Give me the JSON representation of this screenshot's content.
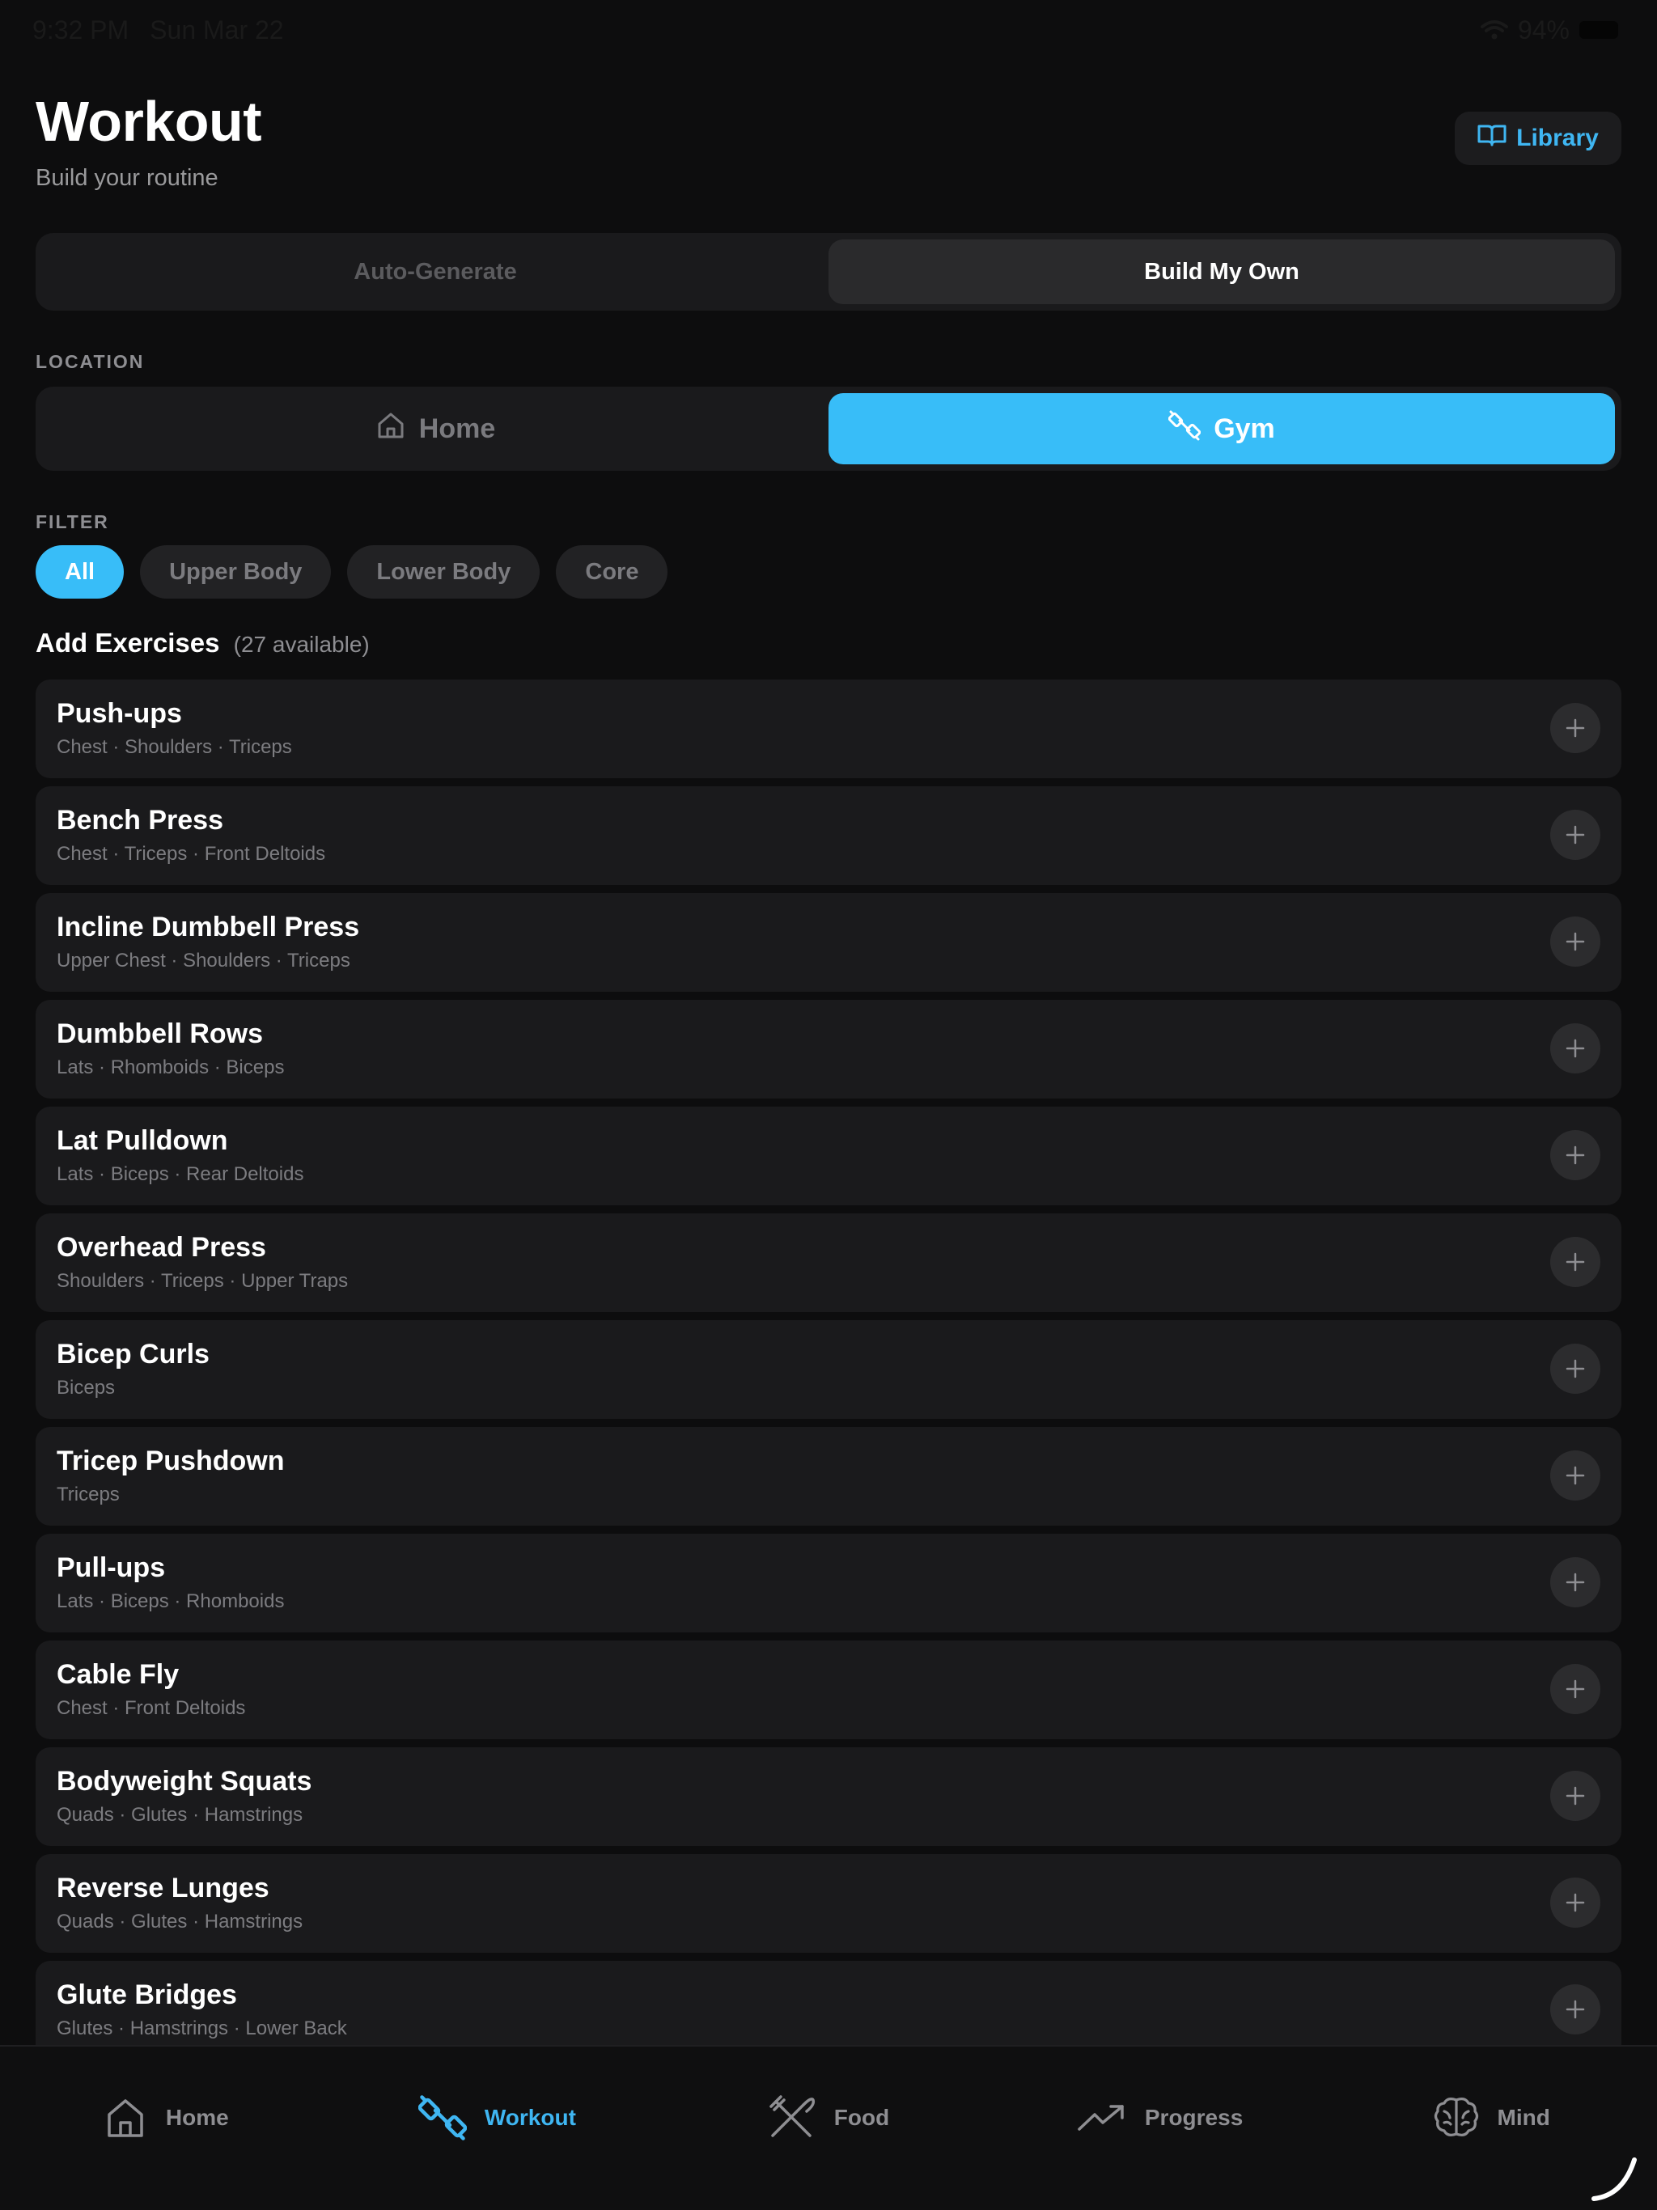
{
  "status_bar": {
    "time": "9:32 PM",
    "date": "Sun Mar 22",
    "battery": "94%"
  },
  "header": {
    "title": "Workout",
    "subtitle": "Build your routine",
    "library_label": "Library"
  },
  "mode": {
    "options": [
      "Auto-Generate",
      "Build My Own"
    ],
    "selected": "Build My Own"
  },
  "location": {
    "label": "LOCATION",
    "options": [
      {
        "label": "Home",
        "icon": "house-icon"
      },
      {
        "label": "Gym",
        "icon": "dumbbell-icon"
      }
    ],
    "selected": "Gym"
  },
  "filter": {
    "label": "FILTER",
    "chips": [
      "All",
      "Upper Body",
      "Lower Body",
      "Core"
    ],
    "selected": "All"
  },
  "exercises": {
    "heading": "Add Exercises",
    "count_text": "(27 available)",
    "items": [
      {
        "name": "Push-ups",
        "muscles": "Chest · Shoulders · Triceps"
      },
      {
        "name": "Bench Press",
        "muscles": "Chest · Triceps · Front Deltoids"
      },
      {
        "name": "Incline Dumbbell Press",
        "muscles": "Upper Chest · Shoulders · Triceps"
      },
      {
        "name": "Dumbbell Rows",
        "muscles": "Lats · Rhomboids · Biceps"
      },
      {
        "name": "Lat Pulldown",
        "muscles": "Lats · Biceps · Rear Deltoids"
      },
      {
        "name": "Overhead Press",
        "muscles": "Shoulders · Triceps · Upper Traps"
      },
      {
        "name": "Bicep Curls",
        "muscles": "Biceps"
      },
      {
        "name": "Tricep Pushdown",
        "muscles": "Triceps"
      },
      {
        "name": "Pull-ups",
        "muscles": "Lats · Biceps · Rhomboids"
      },
      {
        "name": "Cable Fly",
        "muscles": "Chest · Front Deltoids"
      },
      {
        "name": "Bodyweight Squats",
        "muscles": "Quads · Glutes · Hamstrings"
      },
      {
        "name": "Reverse Lunges",
        "muscles": "Quads · Glutes · Hamstrings"
      },
      {
        "name": "Glute Bridges",
        "muscles": "Glutes · Hamstrings · Lower Back"
      }
    ]
  },
  "tab_bar": {
    "tabs": [
      {
        "label": "Home",
        "icon": "house-icon"
      },
      {
        "label": "Workout",
        "icon": "dumbbell-icon"
      },
      {
        "label": "Food",
        "icon": "utensils-icon"
      },
      {
        "label": "Progress",
        "icon": "trending-up-icon"
      },
      {
        "label": "Mind",
        "icon": "brain-icon"
      }
    ],
    "selected": "Workout"
  },
  "colors": {
    "accent": "#38bdf8",
    "background": "#0d0d0e",
    "card": "#1a1a1c"
  }
}
